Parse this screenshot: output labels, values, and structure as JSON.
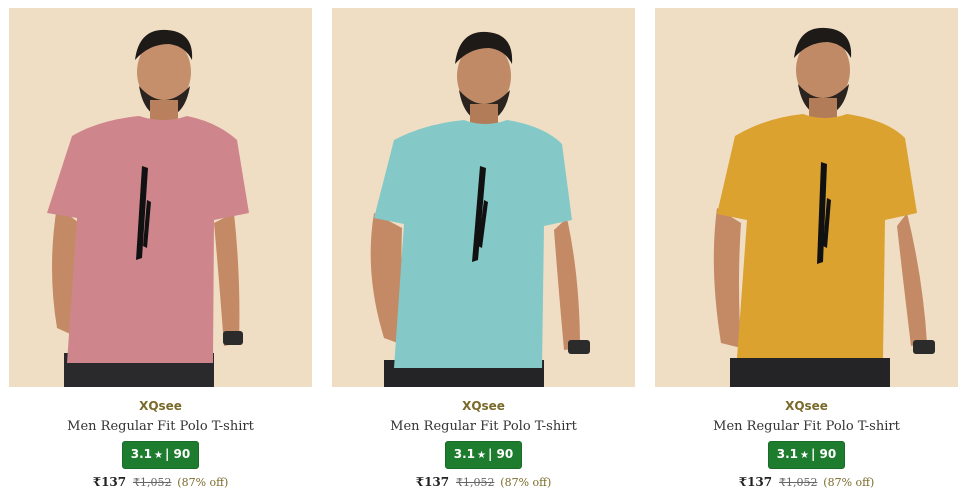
{
  "colors": {
    "background": "#f3e4cc",
    "rating_badge": "#1e7c2f",
    "brand_text": "#7a6a2a"
  },
  "products": [
    {
      "brand": "XQsee",
      "title": "Men Regular Fit Polo T-shirt",
      "rating": "3.1",
      "rating_count": "90",
      "price": "₹137",
      "mrp": "₹1,052",
      "discount": "(87% off)",
      "shirt_color": "#cf858c"
    },
    {
      "brand": "XQsee",
      "title": "Men Regular Fit Polo T-shirt",
      "rating": "3.1",
      "rating_count": "90",
      "price": "₹137",
      "mrp": "₹1,052",
      "discount": "(87% off)",
      "shirt_color": "#84c9c8"
    },
    {
      "brand": "XQsee",
      "title": "Men Regular Fit Polo T-shirt",
      "rating": "3.1",
      "rating_count": "90",
      "price": "₹137",
      "mrp": "₹1,052",
      "discount": "(87% off)",
      "shirt_color": "#dba230"
    }
  ]
}
